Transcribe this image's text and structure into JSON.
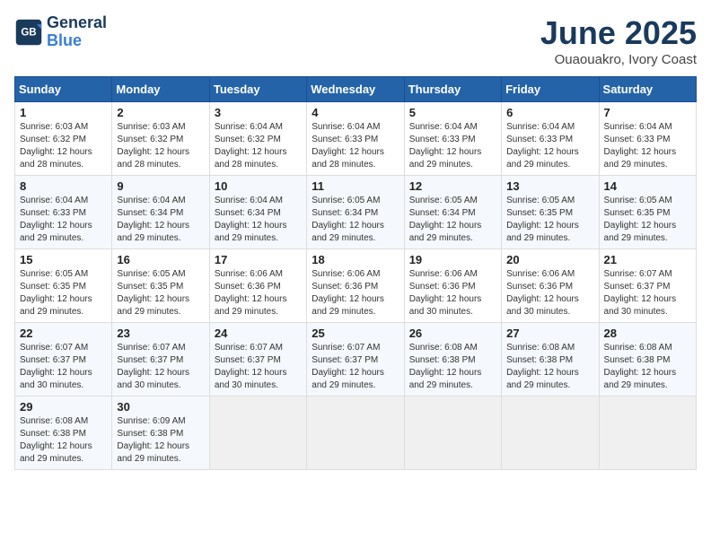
{
  "header": {
    "logo_line1": "General",
    "logo_line2": "Blue",
    "month": "June 2025",
    "location": "Ouaouakro, Ivory Coast"
  },
  "weekdays": [
    "Sunday",
    "Monday",
    "Tuesday",
    "Wednesday",
    "Thursday",
    "Friday",
    "Saturday"
  ],
  "weeks": [
    [
      {
        "day": 1,
        "sunrise": "6:03 AM",
        "sunset": "6:32 PM",
        "daylight": "12 hours and 28 minutes."
      },
      {
        "day": 2,
        "sunrise": "6:03 AM",
        "sunset": "6:32 PM",
        "daylight": "12 hours and 28 minutes."
      },
      {
        "day": 3,
        "sunrise": "6:04 AM",
        "sunset": "6:32 PM",
        "daylight": "12 hours and 28 minutes."
      },
      {
        "day": 4,
        "sunrise": "6:04 AM",
        "sunset": "6:33 PM",
        "daylight": "12 hours and 28 minutes."
      },
      {
        "day": 5,
        "sunrise": "6:04 AM",
        "sunset": "6:33 PM",
        "daylight": "12 hours and 29 minutes."
      },
      {
        "day": 6,
        "sunrise": "6:04 AM",
        "sunset": "6:33 PM",
        "daylight": "12 hours and 29 minutes."
      },
      {
        "day": 7,
        "sunrise": "6:04 AM",
        "sunset": "6:33 PM",
        "daylight": "12 hours and 29 minutes."
      }
    ],
    [
      {
        "day": 8,
        "sunrise": "6:04 AM",
        "sunset": "6:33 PM",
        "daylight": "12 hours and 29 minutes."
      },
      {
        "day": 9,
        "sunrise": "6:04 AM",
        "sunset": "6:34 PM",
        "daylight": "12 hours and 29 minutes."
      },
      {
        "day": 10,
        "sunrise": "6:04 AM",
        "sunset": "6:34 PM",
        "daylight": "12 hours and 29 minutes."
      },
      {
        "day": 11,
        "sunrise": "6:05 AM",
        "sunset": "6:34 PM",
        "daylight": "12 hours and 29 minutes."
      },
      {
        "day": 12,
        "sunrise": "6:05 AM",
        "sunset": "6:34 PM",
        "daylight": "12 hours and 29 minutes."
      },
      {
        "day": 13,
        "sunrise": "6:05 AM",
        "sunset": "6:35 PM",
        "daylight": "12 hours and 29 minutes."
      },
      {
        "day": 14,
        "sunrise": "6:05 AM",
        "sunset": "6:35 PM",
        "daylight": "12 hours and 29 minutes."
      }
    ],
    [
      {
        "day": 15,
        "sunrise": "6:05 AM",
        "sunset": "6:35 PM",
        "daylight": "12 hours and 29 minutes."
      },
      {
        "day": 16,
        "sunrise": "6:05 AM",
        "sunset": "6:35 PM",
        "daylight": "12 hours and 29 minutes."
      },
      {
        "day": 17,
        "sunrise": "6:06 AM",
        "sunset": "6:36 PM",
        "daylight": "12 hours and 29 minutes."
      },
      {
        "day": 18,
        "sunrise": "6:06 AM",
        "sunset": "6:36 PM",
        "daylight": "12 hours and 29 minutes."
      },
      {
        "day": 19,
        "sunrise": "6:06 AM",
        "sunset": "6:36 PM",
        "daylight": "12 hours and 30 minutes."
      },
      {
        "day": 20,
        "sunrise": "6:06 AM",
        "sunset": "6:36 PM",
        "daylight": "12 hours and 30 minutes."
      },
      {
        "day": 21,
        "sunrise": "6:07 AM",
        "sunset": "6:37 PM",
        "daylight": "12 hours and 30 minutes."
      }
    ],
    [
      {
        "day": 22,
        "sunrise": "6:07 AM",
        "sunset": "6:37 PM",
        "daylight": "12 hours and 30 minutes."
      },
      {
        "day": 23,
        "sunrise": "6:07 AM",
        "sunset": "6:37 PM",
        "daylight": "12 hours and 30 minutes."
      },
      {
        "day": 24,
        "sunrise": "6:07 AM",
        "sunset": "6:37 PM",
        "daylight": "12 hours and 30 minutes."
      },
      {
        "day": 25,
        "sunrise": "6:07 AM",
        "sunset": "6:37 PM",
        "daylight": "12 hours and 29 minutes."
      },
      {
        "day": 26,
        "sunrise": "6:08 AM",
        "sunset": "6:38 PM",
        "daylight": "12 hours and 29 minutes."
      },
      {
        "day": 27,
        "sunrise": "6:08 AM",
        "sunset": "6:38 PM",
        "daylight": "12 hours and 29 minutes."
      },
      {
        "day": 28,
        "sunrise": "6:08 AM",
        "sunset": "6:38 PM",
        "daylight": "12 hours and 29 minutes."
      }
    ],
    [
      {
        "day": 29,
        "sunrise": "6:08 AM",
        "sunset": "6:38 PM",
        "daylight": "12 hours and 29 minutes."
      },
      {
        "day": 30,
        "sunrise": "6:09 AM",
        "sunset": "6:38 PM",
        "daylight": "12 hours and 29 minutes."
      },
      null,
      null,
      null,
      null,
      null
    ]
  ],
  "labels": {
    "sunrise": "Sunrise:",
    "sunset": "Sunset:",
    "daylight": "Daylight: "
  }
}
